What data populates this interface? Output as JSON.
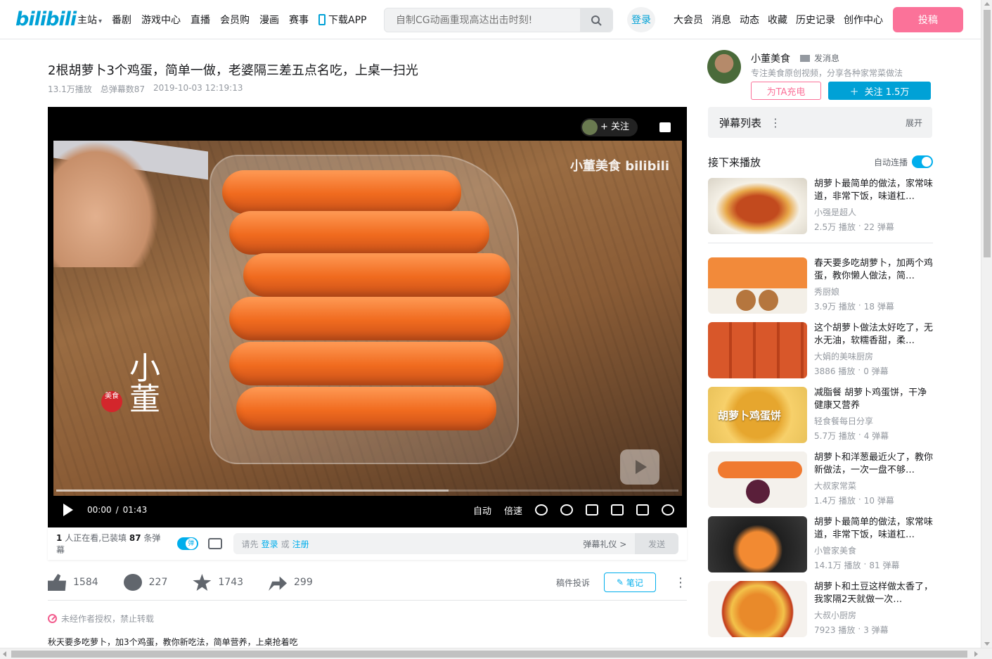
{
  "header": {
    "logo": "bilibili",
    "nav": [
      "主站",
      "番剧",
      "游戏中心",
      "直播",
      "会员购",
      "漫画",
      "赛事"
    ],
    "download": "下载APP",
    "search_placeholder": "自制CG动画重现高达出击时刻!",
    "login": "登录",
    "nav_right": [
      "大会员",
      "消息",
      "动态",
      "收藏",
      "历史记录",
      "创作中心"
    ],
    "upload": "投稿"
  },
  "video": {
    "title": "2根胡萝卜3个鸡蛋，简单一做，老婆隔三差五点名吃，上桌一扫光",
    "plays": "13.1万播放",
    "danmaku_total": "总弹幕数87",
    "date": "2019-10-03 12:19:13",
    "watermark_logo": "小董美食 bilibili",
    "follow_chip": "+ 关注",
    "progress": 0.63,
    "time_current": "00:00",
    "time_sep": "/",
    "time_total": "01:43",
    "ctrl_auto": "自动",
    "ctrl_speed": "倍速"
  },
  "danmaku_bar": {
    "viewers_count": "1",
    "viewers_text": "人正在看,已装填",
    "dm_count": "87",
    "dm_text": "条弹幕",
    "prompt": "请先",
    "login": "登录",
    "or": "或",
    "register": "注册",
    "etiquette": "弹幕礼仪 >",
    "send": "发送"
  },
  "actions": {
    "like": "1584",
    "coin": "227",
    "favorite": "1743",
    "share": "299",
    "report": "稿件投诉",
    "note": "笔记"
  },
  "copyright": "未经作者授权，禁止转载",
  "description": "秋天要多吃萝卜，加3个鸡蛋，教你新吃法，简单营养，上桌抢着吃",
  "uploader": {
    "name": "小董美食",
    "message": "发消息",
    "desc": "专注美食原创视频，分享各种家常菜做法",
    "charge": "为TA充电",
    "follow": "关注 1.5万"
  },
  "danmaku_list": {
    "title": "弹幕列表",
    "expand": "展开"
  },
  "next": {
    "title": "接下来播放",
    "autoplay": "自动连播"
  },
  "recommendations": [
    {
      "title": "胡萝卜最简单的做法，家常味道，非常下饭，味道杠…",
      "up": "小强是超人",
      "plays": "2.5万 播放",
      "danmaku": "22 弹幕"
    },
    {
      "title": "春天要多吃胡萝卜，加两个鸡蛋，教你懒人做法，简…",
      "up": "秀厨娘",
      "plays": "3.9万 播放",
      "danmaku": "18 弹幕"
    },
    {
      "title": "这个胡萝卜做法太好吃了，无水无油，软糯香甜，柔…",
      "up": "大娟的美味厨房",
      "plays": "3886 播放",
      "danmaku": "0 弹幕"
    },
    {
      "title": "减脂餐 胡萝卜鸡蛋饼，干净健康又营养",
      "up": "轻食餐每日分享",
      "plays": "5.7万 播放",
      "danmaku": "4 弹幕",
      "thumb_text": "胡萝卜鸡蛋饼"
    },
    {
      "title": "胡萝卜和洋葱最近火了，教你新做法，一次一盘不够…",
      "up": "大叔家常菜",
      "plays": "1.4万 播放",
      "danmaku": "10 弹幕"
    },
    {
      "title": "胡萝卜最简单的做法，家常味道，非常下饭，味道杠…",
      "up": "小管家美食",
      "plays": "14.1万 播放",
      "danmaku": "81 弹幕"
    },
    {
      "title": "胡萝卜和土豆这样做太香了，我家隔2天就做一次…",
      "up": "大叔小厨房",
      "plays": "7923 播放",
      "danmaku": "3 弹幕"
    }
  ]
}
